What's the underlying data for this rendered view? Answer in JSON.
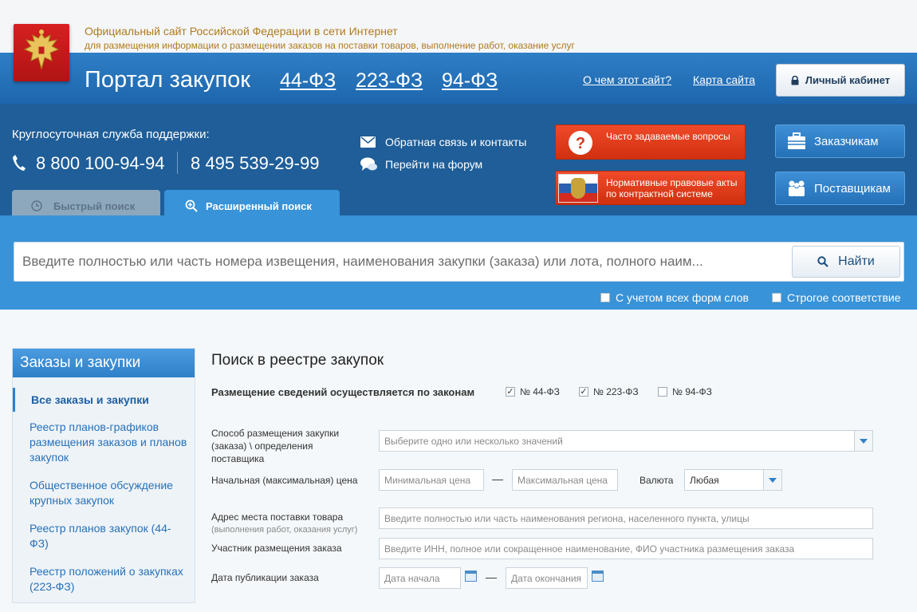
{
  "header": {
    "line1": "Официальный сайт Российской Федерации в сети Интернет",
    "line2": "для размещения информации о размещении заказов на поставки товаров, выполнение работ, оказание услуг",
    "portal_title": "Портал закупок",
    "laws": [
      "44-ФЗ",
      "223-ФЗ",
      "94-ФЗ"
    ],
    "about_link": "О чем этот сайт?",
    "sitemap_link": "Карта сайта",
    "cabinet_button": "Личный кабинет"
  },
  "support": {
    "label": "Круглосуточная служба поддержки:",
    "phone1": "8 800 100-94-94",
    "phone2": "8 495 539-29-99",
    "feedback_link": "Обратная связь и контакты",
    "forum_link": "Перейти на форум"
  },
  "promo": {
    "faq": "Часто задаваемые вопросы",
    "legal": "Нормативные правовые акты по контрактной системе",
    "customers": "Заказчикам",
    "suppliers": "Поставщикам"
  },
  "tabs": {
    "quick": "Быстрый поиск",
    "extended": "Расширенный поиск"
  },
  "search": {
    "placeholder": "Введите полностью или часть номера извещения, наименования закупки (заказа) или лота, полного наим...",
    "button": "Найти",
    "opt_word_forms": "С учетом всех форм слов",
    "opt_strict": "Строгое соответствие"
  },
  "sidebar": {
    "title": "Заказы и закупки",
    "items": [
      "Все заказы и закупки",
      "Реестр планов-графиков размещения заказов и планов закупок",
      "Общественное обсуждение крупных закупок",
      "Реестр планов закупок (44-ФЗ)",
      "Реестр положений о закупках (223-ФЗ)"
    ]
  },
  "form": {
    "title": "Поиск в реестре закупок",
    "laws_label": "Размещение сведений осуществляется по законам",
    "law_options": [
      {
        "label": "№ 44-ФЗ",
        "checked": true
      },
      {
        "label": "№ 223-ФЗ",
        "checked": true
      },
      {
        "label": "№ 94-ФЗ",
        "checked": false
      }
    ],
    "method_label": "Способ размещения закупки (заказа) \\ определения поставщика",
    "method_placeholder": "Выберите одно или несколько значений",
    "price_label": "Начальная (максимальная) цена",
    "price_min": "Минимальная цена",
    "price_max": "Максимальная цена",
    "currency_label": "Валюта",
    "currency_value": "Любая",
    "address_label": "Адрес места поставки товара",
    "address_sub": "(выполнения работ, оказания услуг)",
    "address_placeholder": "Введите полностью или часть наименования региона, населенного пункта, улицы",
    "participant_label": "Участник размещения заказа",
    "participant_placeholder": "Введите ИНН, полное или сокращенное наименование, ФИО участника размещения заказа",
    "date_label": "Дата публикации заказа",
    "date_start": "Дата начала",
    "date_end": "Дата окончания",
    "dash": "—"
  },
  "colors": {
    "header_blue": "#2f7fc6",
    "dark_blue": "#1f5e98",
    "search_blue": "#3893d8",
    "faq_red": "#e4401f",
    "link_blue": "#2671b9",
    "gold_text": "#b07a1e"
  }
}
